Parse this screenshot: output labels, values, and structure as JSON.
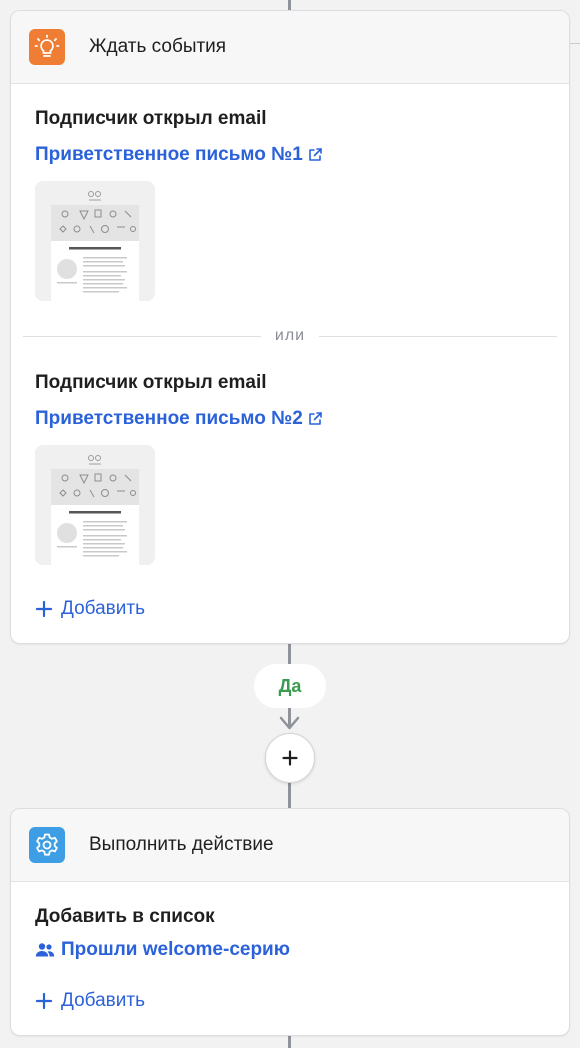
{
  "wait_card": {
    "title": "Ждать события",
    "icon": "lightbulb-icon",
    "icon_color": "#ef7d33",
    "conditions": [
      {
        "title": "Подписчик открыл email",
        "link": "Приветственное письмо №1"
      },
      {
        "title": "Подписчик открыл email",
        "link": "Приветственное письмо №2"
      }
    ],
    "separator": "или",
    "add_label": "Добавить"
  },
  "branch": {
    "label": "Да",
    "label_color": "#3a9b50"
  },
  "action_card": {
    "title": "Выполнить действие",
    "icon": "gear-icon",
    "icon_color": "#3d9ee5",
    "action_title": "Добавить в список",
    "list_name": "Прошли welcome-серию",
    "add_label": "Добавить"
  },
  "link_color": "#2b62d9"
}
